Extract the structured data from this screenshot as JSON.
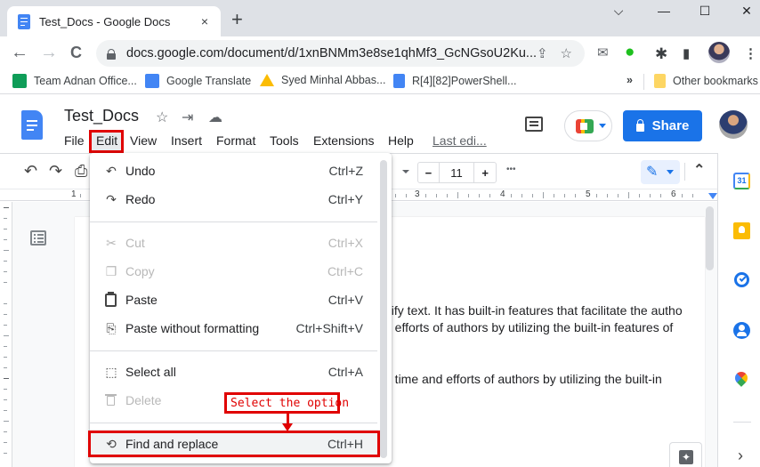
{
  "browser": {
    "tab": {
      "title": "Test_Docs - Google Docs",
      "close_icon": "×"
    },
    "new_tab_icon": "+",
    "window_controls": {
      "tab_search": "⌵",
      "minimize": "—",
      "maximize": "☐",
      "close": "✕"
    },
    "nav": {
      "back": "←",
      "forward": "→",
      "reload": "C"
    },
    "url": "docs.google.com/document/d/1xnBNMm3e8se1qhMf3_GcNGsoU2Ku...",
    "omnibox_icons": {
      "share": "⇪",
      "bookmark_star": "☆"
    },
    "extension_icons": {
      "mail": "✉",
      "extension_green": "●",
      "puzzle": "✱",
      "sidepanel": "▮",
      "menu": "⋮"
    },
    "bookmarks": [
      {
        "label": "Team Adnan Office...",
        "icon": "sheets-icon",
        "color": "#0f9d58"
      },
      {
        "label": "Google Translate",
        "icon": "translate-icon",
        "color": "#4285f4"
      },
      {
        "label": "Syed Minhal Abbas...",
        "icon": "drive-icon",
        "color": "#fbbc04"
      },
      {
        "label": "R[4][82]PowerShell...",
        "icon": "docs-icon",
        "color": "#4285f4"
      }
    ],
    "bookmarks_overflow": "»",
    "other_bookmarks": "Other bookmarks"
  },
  "docs": {
    "title": "Test_Docs",
    "title_icons": {
      "star": "☆",
      "move": "⇥",
      "cloud": "☁"
    },
    "menus": [
      "File",
      "Edit",
      "View",
      "Insert",
      "Format",
      "Tools",
      "Extensions",
      "Help"
    ],
    "last_edit": "Last edi...",
    "share_label": "Share",
    "accent_color": "#1a73e8",
    "toolbar": {
      "undo": "↶",
      "redo": "↷",
      "print": "⎙",
      "font_size": "11",
      "font_minus": "−",
      "font_plus": "+",
      "more": "•••",
      "edit_mode_icon": "✎",
      "collapse": "⌃"
    },
    "ruler_numbers": [
      "1",
      "3",
      "4",
      "5",
      "6"
    ],
    "body_lines": [
      "dify text. It has built-in features that facilitate the autho",
      "d efforts of authors by utilizing the built-in features of",
      "e time and efforts of authors by utilizing the built-in"
    ],
    "explore_icon": "✦",
    "side_panel_icons": [
      "calendar-icon",
      "keep-icon",
      "tasks-icon",
      "contacts-icon",
      "maps-icon"
    ],
    "side_panel_calendar_text": "31",
    "side_panel_expand": "›"
  },
  "edit_menu": {
    "items": [
      {
        "label": "Undo",
        "shortcut": "Ctrl+Z",
        "icon": "↶",
        "disabled": false
      },
      {
        "label": "Redo",
        "shortcut": "Ctrl+Y",
        "icon": "↷",
        "disabled": false
      },
      {
        "label": "Cut",
        "shortcut": "Ctrl+X",
        "icon": "✂",
        "disabled": true
      },
      {
        "label": "Copy",
        "shortcut": "Ctrl+C",
        "icon": "❐",
        "disabled": true
      },
      {
        "label": "Paste",
        "shortcut": "Ctrl+V",
        "icon": "📋",
        "disabled": false
      },
      {
        "label": "Paste without formatting",
        "shortcut": "Ctrl+Shift+V",
        "icon": "⎘",
        "disabled": false
      },
      {
        "label": "Select all",
        "shortcut": "Ctrl+A",
        "icon": "⬚",
        "disabled": false
      },
      {
        "label": "Delete",
        "shortcut": "",
        "icon": "🗑",
        "disabled": true
      },
      {
        "label": "Find and replace",
        "shortcut": "Ctrl+H",
        "icon": "⟲",
        "disabled": false
      }
    ]
  },
  "annotation": {
    "callout_text": "Select the option",
    "color": "#e00000"
  }
}
